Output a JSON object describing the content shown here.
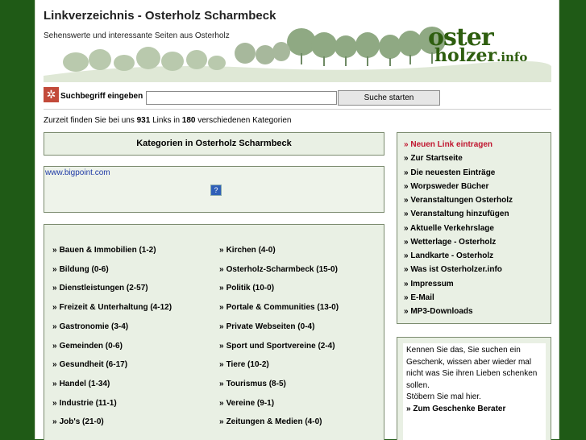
{
  "header": {
    "title": "Linkverzeichnis - Osterholz Scharmbeck",
    "subtitle": "Sehenswerte und interessante Seiten aus Osterholz",
    "logo_line1": "oster",
    "logo_line2": "holzer",
    "logo_tld": ".info"
  },
  "search": {
    "label": "Suchbegriff eingeben",
    "input_value": "",
    "button_label": "Suche starten"
  },
  "stats": {
    "prefix": "Zurzeit finden Sie bei uns",
    "links_count": "931",
    "middle": "Links in",
    "category_count": "180",
    "suffix": "verschiedenen Kategorien"
  },
  "categories": {
    "title": "Kategorien in Osterholz Scharmbeck",
    "ad_link": "www.bigpoint.com",
    "left": [
      "Bauen & Immobilien (1-2)",
      "Bildung (0-6)",
      "Dienstleistungen (2-57)",
      "Freizeit & Unterhaltung (4-12)",
      "Gastronomie (3-4)",
      "Gemeinden (0-6)",
      "Gesundheit (6-17)",
      "Handel (1-34)",
      "Industrie (11-1)",
      "Job's (21-0)"
    ],
    "right": [
      "Kirchen (4-0)",
      "Osterholz-Scharmbeck (15-0)",
      "Politik (10-0)",
      "Portale & Communities (13-0)",
      "Private Webseiten (0-4)",
      "Sport und Sportvereine (2-4)",
      "Tiere (10-2)",
      "Tourismus (8-5)",
      "Vereine (9-1)",
      "Zeitungen & Medien (4-0)"
    ]
  },
  "nav": {
    "bullet": "»",
    "items": [
      "Neuen Link eintragen",
      "Zur Startseite",
      "Die neuesten Einträge",
      "Worpsweder Bücher",
      "Veranstaltungen Osterholz",
      "Veranstaltung hinzufügen",
      "Aktuelle Verkehrslage",
      "Wetterlage - Osterholz",
      "Landkarte - Osterholz",
      "Was ist Osterholzer.info",
      "Impressum",
      "E-Mail",
      "MP3-Downloads"
    ]
  },
  "gift": {
    "text": "Kennen Sie das, Sie suchen ein Geschenk, wissen aber wieder mal nicht was Sie ihren Lieben schenken sollen.",
    "text2": "Stöbern Sie mal hier.",
    "link": "» Zum Geschenke Berater"
  },
  "colors": {
    "background": "#1f5a16",
    "box": "#e9f0e4",
    "highlight": "#c0152e",
    "logo": "#2e5e0f"
  }
}
